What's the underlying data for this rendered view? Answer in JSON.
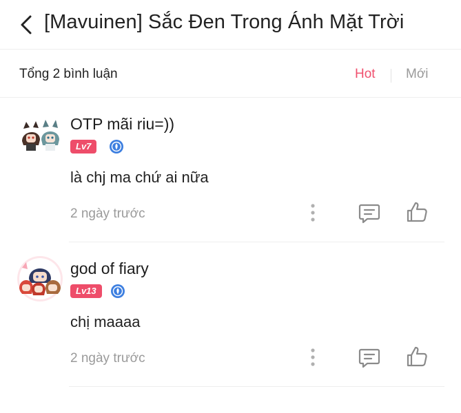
{
  "header": {
    "title": "[Mavuinen] Sắc Đen Trong Ánh Mặt Trời"
  },
  "bar": {
    "total_label": "Tổng 2 bình luận",
    "sort_hot": "Hot",
    "sort_new": "Mới"
  },
  "colors": {
    "accent": "#f0506e",
    "level_badge": "#ee4d6a",
    "verify": "#3d7fe0",
    "muted": "#9a9a9a"
  },
  "comments": [
    {
      "username": "OTP mãi riu=))",
      "level": "Lv7",
      "text": "là chj ma chứ ai nữa",
      "time": "2 ngày trước"
    },
    {
      "username": "god of fiary",
      "level": "Lv13",
      "text": "chị maaaa",
      "time": "2 ngày trước"
    }
  ],
  "icons": {
    "back": "chevron-left-icon",
    "more": "more-vertical-icon",
    "reply": "comment-icon",
    "like": "thumbs-up-icon",
    "verify": "verified-badge-icon"
  }
}
